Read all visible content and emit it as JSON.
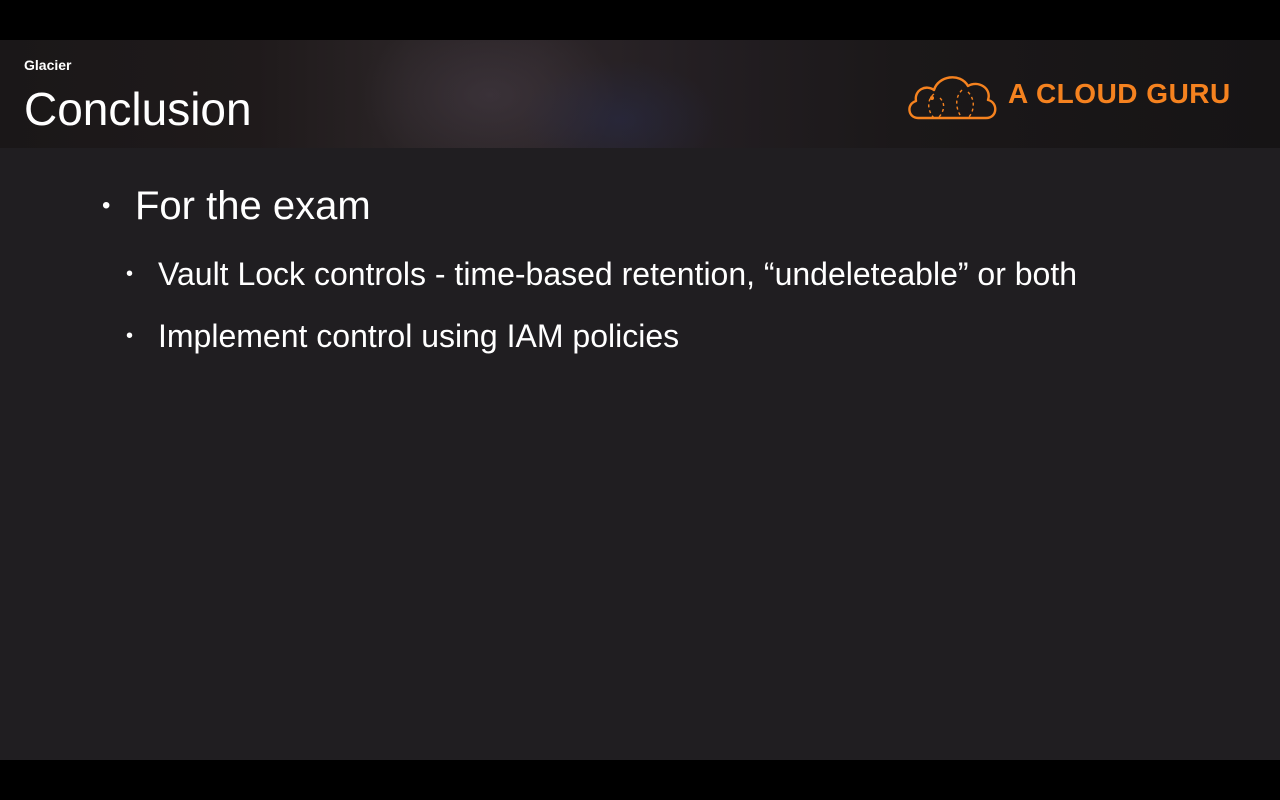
{
  "slide": {
    "section_label": "Glacier",
    "title": "Conclusion"
  },
  "logo": {
    "text": "A CLOUD GURU",
    "icon": "cloud-icon",
    "color": "#f5821f"
  },
  "bullets": [
    {
      "level": 1,
      "text": "For the exam"
    },
    {
      "level": 2,
      "text": "Vault Lock controls - time-based retention, “undeleteable” or both"
    },
    {
      "level": 2,
      "text": "Implement control using IAM policies"
    }
  ],
  "bullet_symbol": "•",
  "colors": {
    "background": "#201e21",
    "text": "#ffffff",
    "accent": "#f5821f"
  }
}
